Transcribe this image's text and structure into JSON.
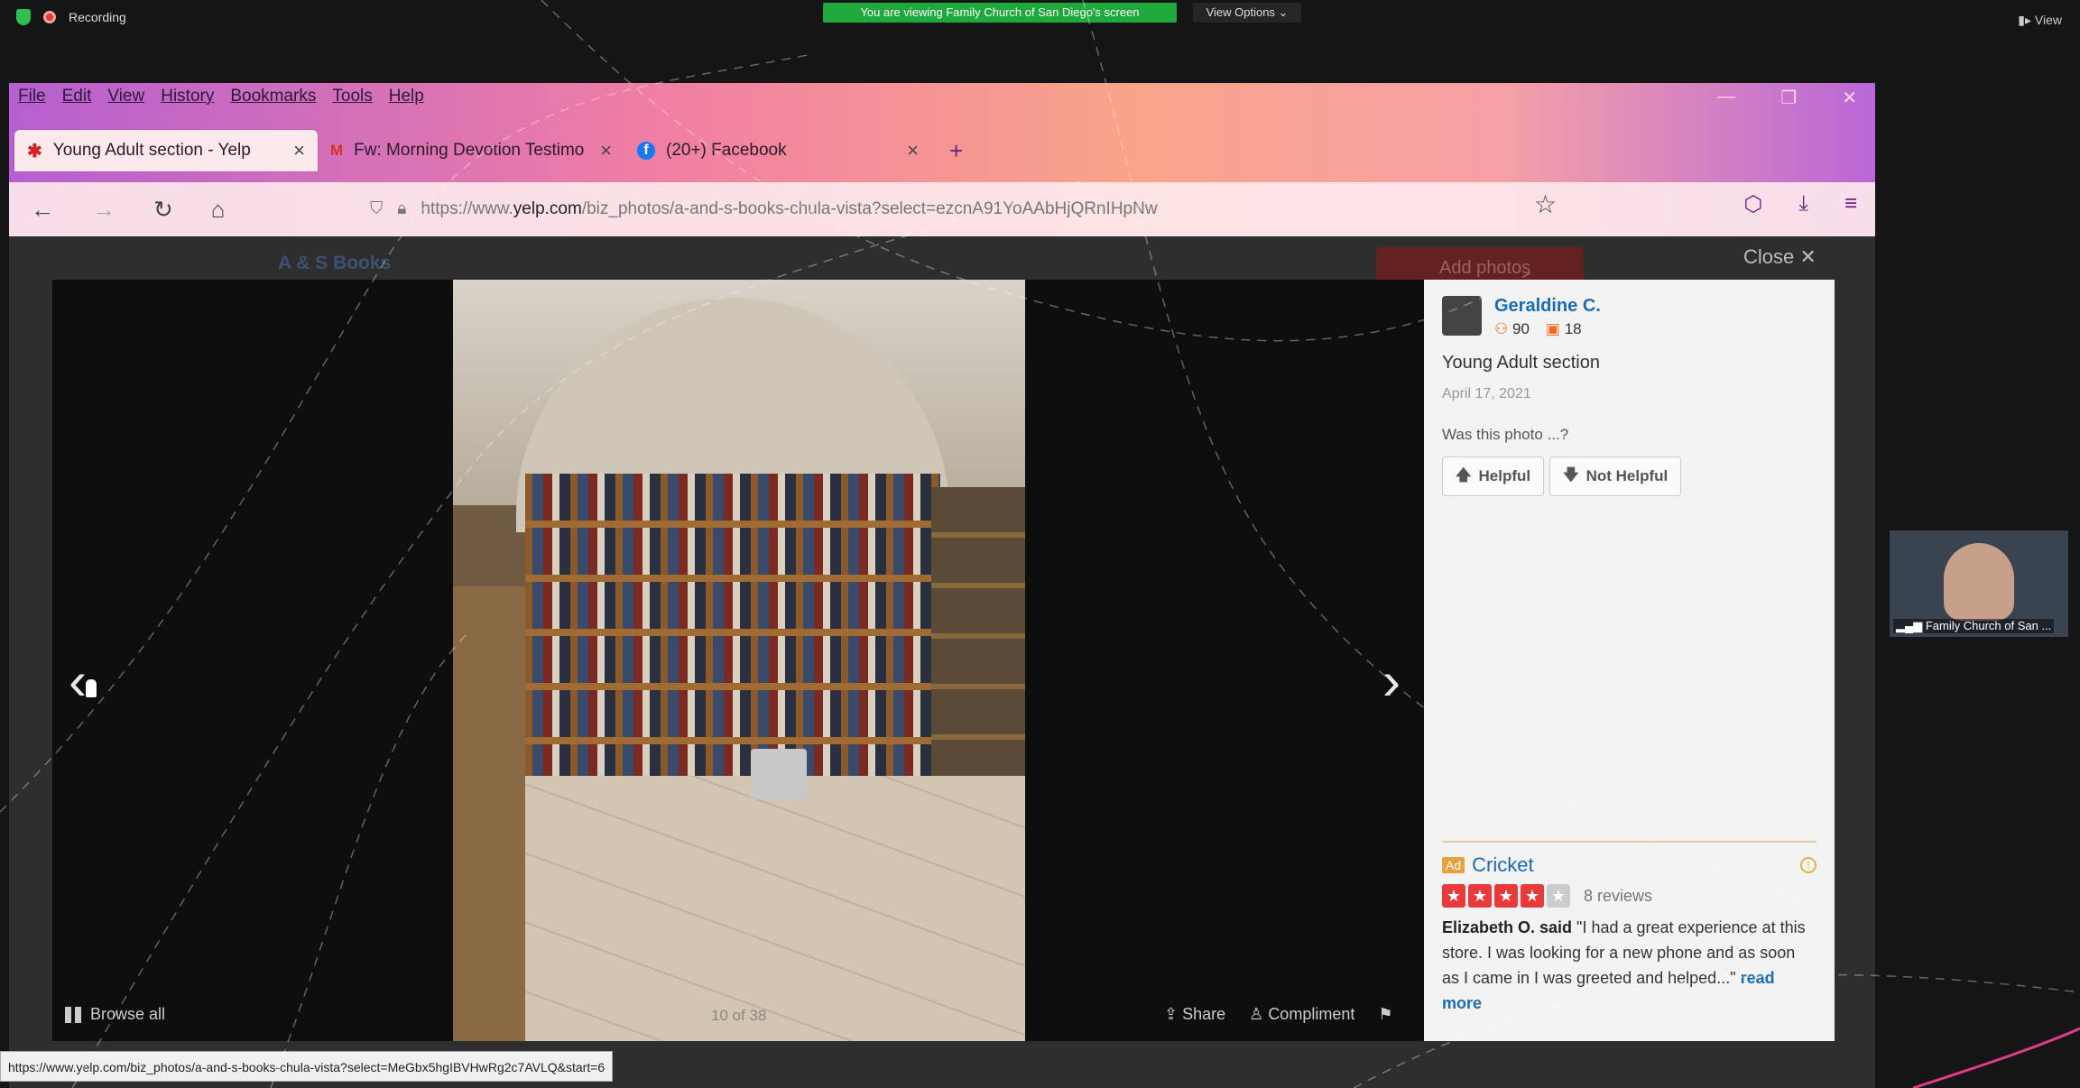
{
  "zoom": {
    "recording_label": "Recording",
    "share_banner": "You are viewing Family Church of San Diego's screen",
    "view_options": "View Options ⌄",
    "view_label": "View",
    "participant_name": "Family Church of San ..."
  },
  "browser": {
    "menu": [
      "File",
      "Edit",
      "View",
      "History",
      "Bookmarks",
      "Tools",
      "Help"
    ],
    "tabs": [
      {
        "label": "Young Adult section - Yelp",
        "icon": "yelp-icon",
        "active": true
      },
      {
        "label": "Fw: Morning Devotion Testimo",
        "icon": "gmail-icon",
        "active": false
      },
      {
        "label": "(20+) Facebook",
        "icon": "facebook-icon",
        "active": false
      }
    ],
    "url_prefix": "https://www.",
    "url_host": "yelp.com",
    "url_path": "/biz_photos/a-and-s-books-chula-vista?select=ezcnA91YoAAbHjQRnIHpNw",
    "status_url": "https://www.yelp.com/biz_photos/a-and-s-books-chula-vista?select=MeGbx5hgIBVHwRg2c7AVLQ&start=6"
  },
  "yelp": {
    "biz_name": "A & S Books",
    "add_photos": "Add photos",
    "close_label": "Close",
    "browse_all": "Browse all",
    "counter": "10 of 38",
    "share": "Share",
    "compliment": "Compliment",
    "sidebar": {
      "user_name": "Geraldine C.",
      "friends": "90",
      "reviews": "18",
      "caption": "Young Adult section",
      "date": "April 17, 2021",
      "question": "Was this photo ...?",
      "helpful": "Helpful",
      "not_helpful": "Not Helpful",
      "ad": {
        "tag": "Ad",
        "name": "Cricket",
        "reviews": "8 reviews",
        "rating": 4,
        "reviewer": "Elizabeth O. said",
        "quote": " \"I had a great experience at this store. I was looking for a new phone and as soon as I came in I was greeted and helped...\"",
        "read_more": "read more"
      }
    }
  },
  "colors": {
    "accent": "#d32323",
    "link": "#1a6bb5",
    "banner": "#1fa83b"
  }
}
